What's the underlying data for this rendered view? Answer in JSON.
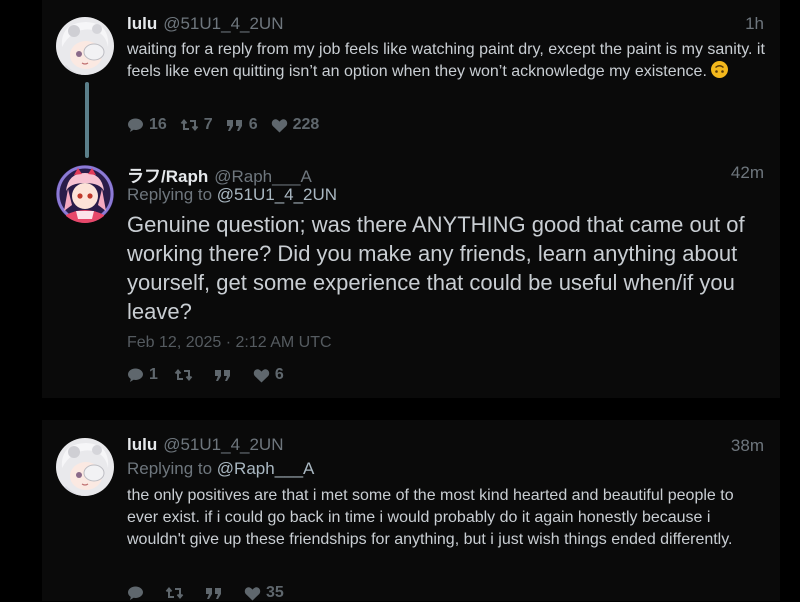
{
  "tweet1": {
    "name": "lulu",
    "handle": "@51U1_4_2UN",
    "time": "1h",
    "text": "waiting for a reply from my job feels like watching paint dry, except the paint is my sanity. it feels like even quitting isn’t an option when they won’t acknowledge my existence.",
    "replies": "16",
    "retweets": "7",
    "quotes": "6",
    "likes": "228"
  },
  "tweet2": {
    "name": "ラフ/Raph",
    "handle": "@Raph___A",
    "time": "42m",
    "replying_prefix": "Replying to",
    "replying_to": "@51U1_4_2UN",
    "text": "Genuine question; was there ANYTHING good that came out of working there? Did you make any friends, learn anything about yourself, get some experience that could be useful when/if you leave?",
    "date": "Feb 12, 2025 · 2:12 AM UTC",
    "replies": "1",
    "likes": "6"
  },
  "tweet3": {
    "name": "lulu",
    "handle": "@51U1_4_2UN",
    "time": "38m",
    "replying_prefix": "Replying to",
    "replying_to": "@Raph___A",
    "text": "the only positives are that i met some of the most kind hearted and beautiful people to ever exist. if i could go back in time i would probably do it again honestly because i wouldn't give up these friendships for anything, but i just wish things ended differently.",
    "likes": "35"
  },
  "icons": {
    "reply": "comment-icon",
    "retweet": "retweet-icon",
    "quote": "quote-icon",
    "like": "heart-icon",
    "emoji": "upside-down-face-emoji"
  },
  "colors": {
    "background": "#000000",
    "card": "#0a0a0a",
    "thread_line": "#5b7f8a",
    "muted": "#6e767d"
  }
}
